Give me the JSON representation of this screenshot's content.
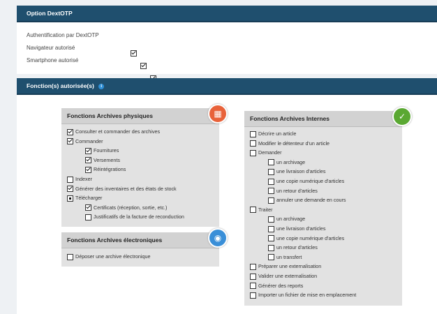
{
  "option_panel": {
    "title": "Option DextOTP",
    "rows": [
      {
        "label": "Authentification par DextOTP",
        "checked": true
      },
      {
        "label": "Navigateur autorisé",
        "checked": true
      },
      {
        "label": "Smartphone autorisé",
        "checked": true
      }
    ]
  },
  "functions_panel": {
    "title": "Fonction(s) autorisée(s)",
    "info_icon": "i"
  },
  "physiques": {
    "title": "Fonctions Archives physiques",
    "icon": "archive-box-icon",
    "items": [
      {
        "label": "Consulter et commander des archives",
        "state": "checked",
        "level": 0
      },
      {
        "label": "Commander",
        "state": "checked",
        "level": 0
      },
      {
        "label": "Fournitures",
        "state": "checked",
        "level": 1
      },
      {
        "label": "Versements",
        "state": "checked",
        "level": 1
      },
      {
        "label": "Réintégrations",
        "state": "checked",
        "level": 1
      },
      {
        "label": "Indexer",
        "state": "unchecked",
        "level": 0
      },
      {
        "label": "Générer des inventaires et des états de stock",
        "state": "checked",
        "level": 0
      },
      {
        "label": "Télécharger",
        "state": "partial",
        "level": 0
      },
      {
        "label": "Certificats (réception, sortie, etc.)",
        "state": "checked",
        "level": 1
      },
      {
        "label": "Justificatifs de la facture de reconduction",
        "state": "unchecked",
        "level": 1
      }
    ]
  },
  "electroniques": {
    "title": "Fonctions Archives électroniques",
    "icon": "disc-icon",
    "items": [
      {
        "label": "Déposer une archive électronique",
        "state": "unchecked",
        "level": 0
      }
    ]
  },
  "internes": {
    "title": "Fonctions Archives Internes",
    "icon": "internal-archive-icon",
    "items": [
      {
        "label": "Décrire un article",
        "state": "unchecked",
        "level": 0
      },
      {
        "label": "Modifier le détenteur d'un article",
        "state": "unchecked",
        "level": 0
      },
      {
        "label": "Demander",
        "state": "unchecked",
        "level": 0
      },
      {
        "label": "un archivage",
        "state": "unchecked",
        "level": 1
      },
      {
        "label": "une livraison d'articles",
        "state": "unchecked",
        "level": 1
      },
      {
        "label": "une copie numérique d'articles",
        "state": "unchecked",
        "level": 1
      },
      {
        "label": "un retour d'articles",
        "state": "unchecked",
        "level": 1
      },
      {
        "label": "annuler une demande en cours",
        "state": "unchecked",
        "level": 1
      },
      {
        "label": "Traiter",
        "state": "unchecked",
        "level": 0
      },
      {
        "label": "un archivage",
        "state": "unchecked",
        "level": 1
      },
      {
        "label": "une livraison d'articles",
        "state": "unchecked",
        "level": 1
      },
      {
        "label": "une copie numérique d'articles",
        "state": "unchecked",
        "level": 1
      },
      {
        "label": "un retour d'articles",
        "state": "unchecked",
        "level": 1
      },
      {
        "label": "un transfert",
        "state": "unchecked",
        "level": 1
      },
      {
        "label": "Préparer une externalisation",
        "state": "unchecked",
        "level": 0
      },
      {
        "label": "Valider une externalisation",
        "state": "unchecked",
        "level": 0
      },
      {
        "label": "Générer des reports",
        "state": "unchecked",
        "level": 0
      },
      {
        "label": "Importer un fichier de mise en emplacement",
        "state": "unchecked",
        "level": 0
      }
    ]
  }
}
